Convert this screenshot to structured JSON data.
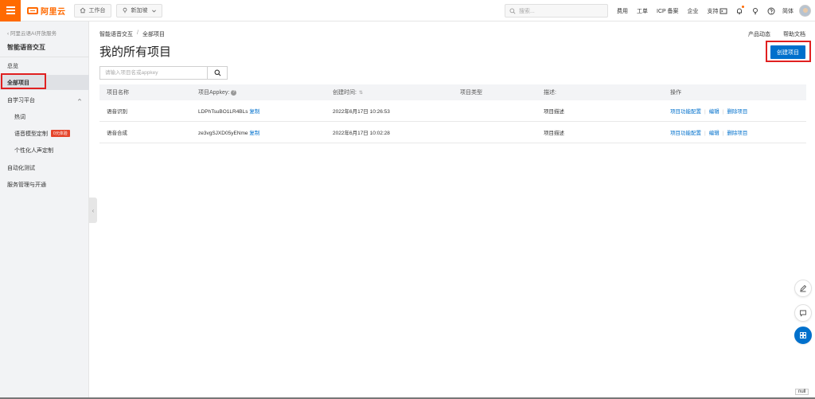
{
  "topbar": {
    "logo_text": "阿里云",
    "workbench_label": "工作台",
    "region_label": "新加坡",
    "search_placeholder": "搜索...",
    "links": [
      "费用",
      "工单",
      "ICP 备案",
      "企业",
      "支持"
    ],
    "lang_label": "简体"
  },
  "sidebar": {
    "back_label": "阿里云语AI开放服务",
    "title": "智能语音交互",
    "items": [
      {
        "label": "总览"
      },
      {
        "label": "全部项目"
      },
      {
        "label": "自学习平台"
      },
      {
        "label": "热词"
      },
      {
        "label": "语音模型定制"
      },
      {
        "label": "个性化人声定制"
      },
      {
        "label": "自动化测试"
      },
      {
        "label": "服务管理与开通"
      }
    ],
    "hot_tag": "0元体验"
  },
  "main": {
    "breadcrumb": [
      "智能语音交互",
      "/",
      "全部项目"
    ],
    "page_title": "我的所有项目",
    "product_news": "产品动态",
    "help_docs": "帮助文档",
    "create_label": "创建项目",
    "search_placeholder": "请输入项目名或appkey"
  },
  "table": {
    "headers": [
      "项目名称",
      "项目Appkey:",
      "创建时间:",
      "项目类型",
      "描述:",
      "操作"
    ],
    "rows": [
      {
        "name": "语音识别",
        "appkey": "LDPhTsuBO1LR4BLs",
        "copy": "复制",
        "created": "2022年6月17日 10:26:53",
        "type": "",
        "desc": "项目描述",
        "op1": "项目功能配置",
        "op2": "编辑",
        "op3": "删除项目"
      },
      {
        "name": "语音合成",
        "appkey": "ze3vgSJXD05yENme",
        "copy": "复制",
        "created": "2022年6月17日 10:02:28",
        "type": "",
        "desc": "项目描述",
        "op1": "项目功能配置",
        "op2": "编辑",
        "op3": "删除项目"
      }
    ]
  },
  "null_label": "null",
  "colors": {
    "accent": "#ff6a00",
    "primary": "#0070cc",
    "highlight": "#e02020"
  }
}
